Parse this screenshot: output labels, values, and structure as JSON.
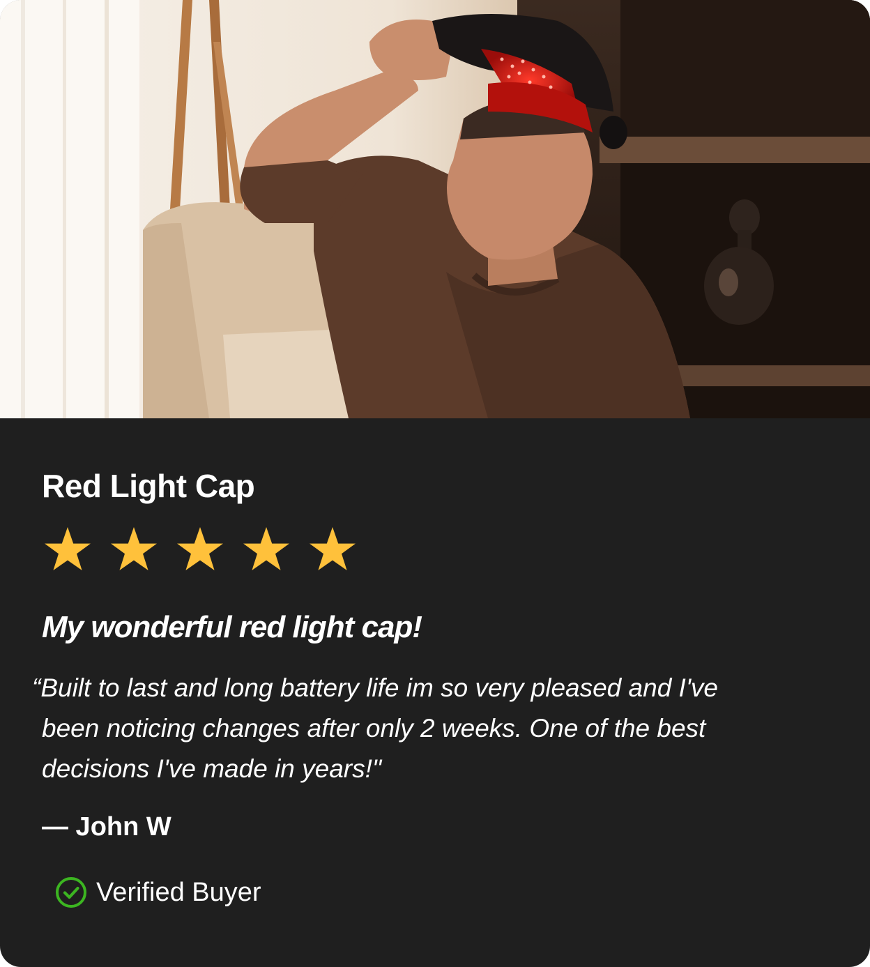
{
  "hero_image": {
    "alt": "Man wearing a red light therapy cap"
  },
  "product": {
    "title": "Red Light Cap"
  },
  "rating": {
    "value": 5,
    "max": 5,
    "star_color": "#ffc13b"
  },
  "review": {
    "title": "My wonderful red light cap!",
    "quote_lines": [
      "“Built to last and long battery life im so very pleased and I've",
      "been noticing changes after only 2 weeks. One of the best",
      "decisions I've made in years!\""
    ],
    "author": "— John W"
  },
  "verified": {
    "icon": "check-circle-icon",
    "label": "Verified Buyer",
    "color": "#3cb521"
  },
  "colors": {
    "card_background": "#1f1f1f",
    "text": "#ffffff"
  }
}
